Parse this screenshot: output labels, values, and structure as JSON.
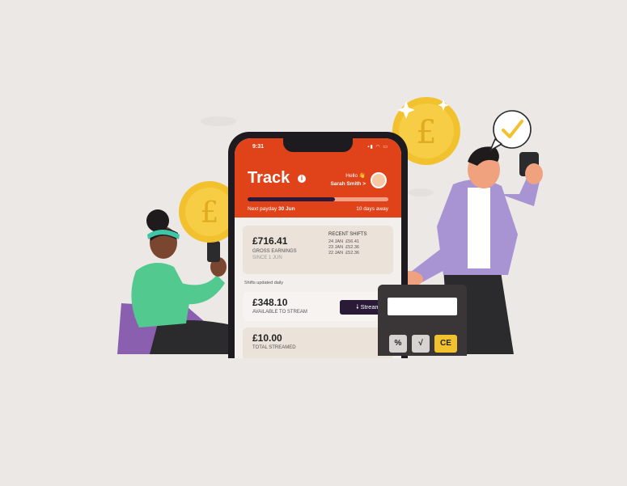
{
  "phone": {
    "status_time": "9:31",
    "title": "Track",
    "info_icon": "i",
    "greeting": "Hello 👋",
    "user_name": "Sarah Smith >",
    "payday_prefix": "Next payday",
    "payday_date": "30 Jun",
    "days_away": "10 days away",
    "progress_fraction": 0.62,
    "gross_amount": "£716.41",
    "gross_label": "GROSS EARNINGS",
    "gross_sub": "SINCE 1 JUN",
    "recent_shifts_title": "RECENT SHIFTS",
    "recent_shifts": [
      {
        "date": "24 JAN",
        "amount": "£56.41"
      },
      {
        "date": "23 JAN",
        "amount": "£52.36"
      },
      {
        "date": "22 JAN",
        "amount": "£52.36"
      }
    ],
    "updated_note": "Shifts updated daily",
    "available_amount": "£348.10",
    "available_label": "AVAILABLE TO STREAM",
    "stream_button": "Stream",
    "streamed_amount": "£10.00",
    "streamed_label": "TOTAL STREAMED"
  },
  "calculator": {
    "keys": [
      "%",
      "√",
      "CE"
    ]
  },
  "coin_symbol": "£",
  "colors": {
    "background": "#ece8e5",
    "accent": "#e0431a",
    "dark": "#2a1a38",
    "coin": "#f2c22e",
    "check": "#f2c22e"
  }
}
